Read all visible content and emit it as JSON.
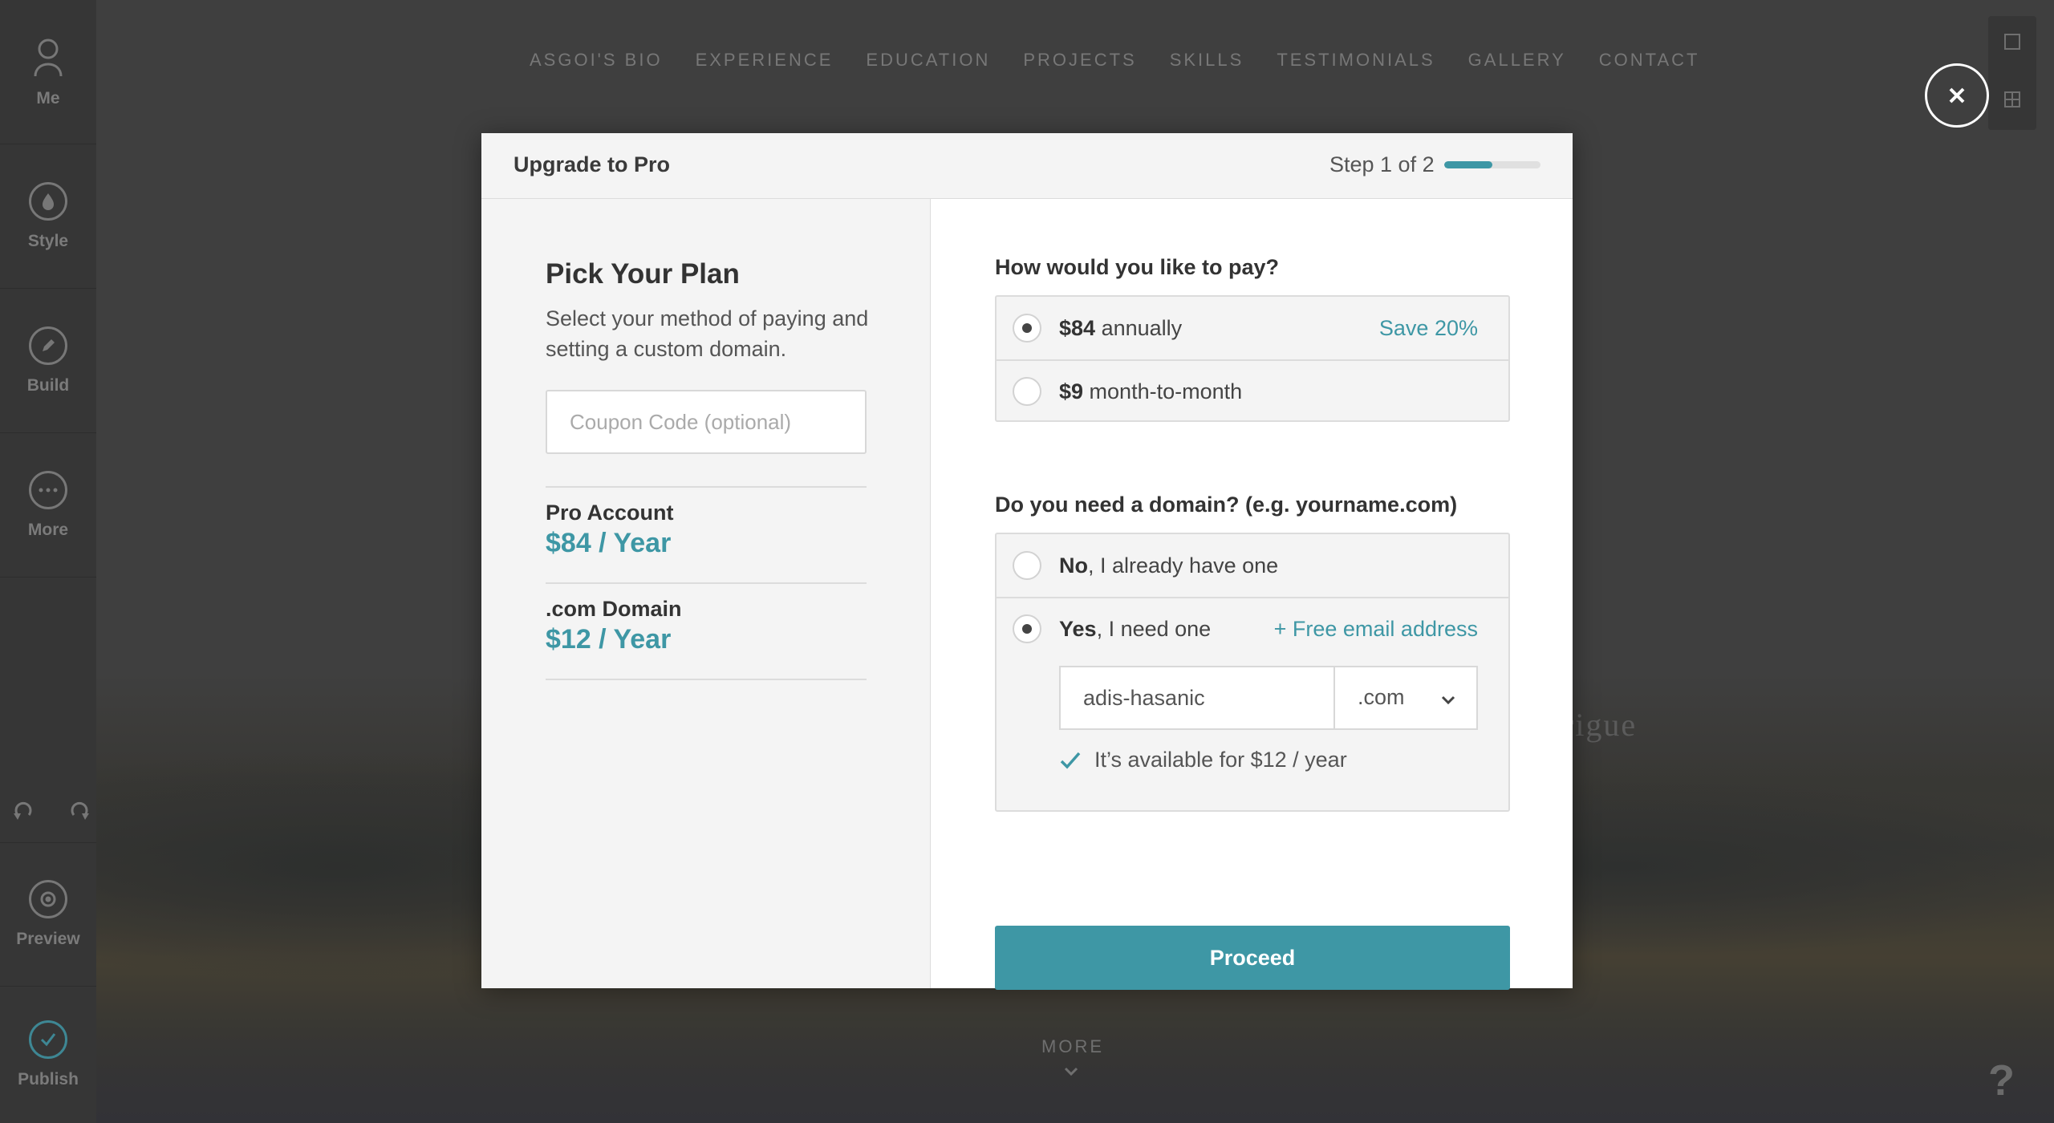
{
  "background": {
    "nav": [
      "ASGOI'S BIO",
      "EXPERIENCE",
      "EDUCATION",
      "PROJECTS",
      "SKILLS",
      "TESTIMONIALS",
      "GALLERY",
      "CONTACT"
    ],
    "partial_word": "rigue",
    "more_label": "MORE",
    "help_label": "?"
  },
  "sidebar": {
    "items": [
      {
        "label": "Me",
        "icon": "user-icon"
      },
      {
        "label": "Style",
        "icon": "droplet-icon"
      },
      {
        "label": "Build",
        "icon": "pencil-icon"
      },
      {
        "label": "More",
        "icon": "more-dots-icon"
      },
      {
        "label": "Preview",
        "icon": "eye-icon"
      },
      {
        "label": "Publish",
        "icon": "check-circle-icon"
      }
    ],
    "undo_icon": "undo-icon",
    "redo_icon": "redo-icon"
  },
  "modal": {
    "title": "Upgrade to Pro",
    "step_text": "Step 1 of 2",
    "step_progress": 0.5,
    "accent": "#3e97a5",
    "left": {
      "heading": "Pick Your Plan",
      "description": "Select your method of paying and setting a custom domain.",
      "coupon_placeholder": "Coupon Code (optional)",
      "summary": [
        {
          "label": "Pro Account",
          "price": "$84 / Year"
        },
        {
          "label": ".com Domain",
          "price": "$12 / Year"
        }
      ]
    },
    "payment": {
      "question": "How would you like to pay?",
      "options": [
        {
          "amount": "$84",
          "text": " annually",
          "note": "Save 20%",
          "selected": true
        },
        {
          "amount": "$9",
          "text": " month-to-month",
          "note": "",
          "selected": false
        }
      ]
    },
    "domain": {
      "question": "Do you need a domain? (e.g. yourname.com)",
      "options": [
        {
          "bold": "No",
          "text": ", I already have one",
          "note": "",
          "selected": false
        },
        {
          "bold": "Yes",
          "text": ", I need one",
          "note": "+ Free email address",
          "selected": true
        }
      ],
      "input_value": "adis-hasanic",
      "tld": ".com",
      "availability": "It’s available for $12 / year"
    },
    "proceed_label": "Proceed"
  }
}
